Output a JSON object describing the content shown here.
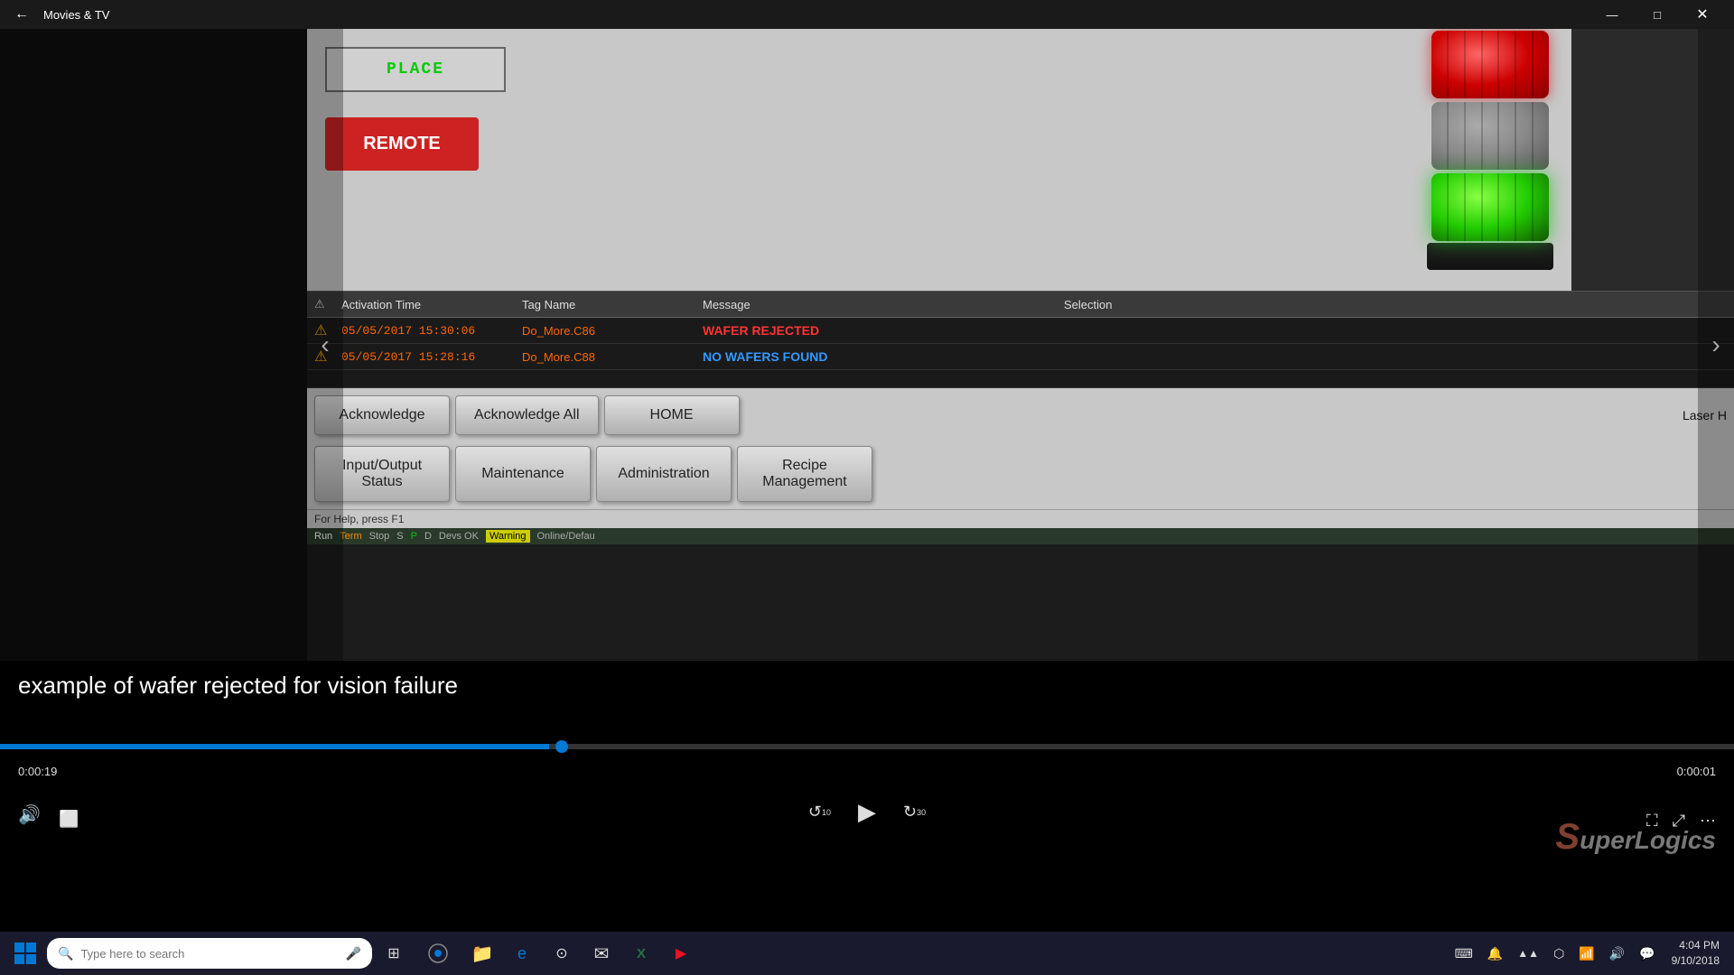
{
  "titlebar": {
    "title": "Movies & TV",
    "back_label": "←",
    "minimize": "—",
    "maximize": "□",
    "close": "✕"
  },
  "hmi": {
    "place_label": "PLACE",
    "remote_label": "REMOTE",
    "alarm_headers": {
      "icon": "",
      "activation_time": "Activation Time",
      "tag_name": "Tag Name",
      "message": "Message",
      "selection": "Selection"
    },
    "alarms": [
      {
        "time": "05/05/2017 15:30:06",
        "tag": "Do_More.C86",
        "message": "WAFER REJECTED"
      },
      {
        "time": "05/05/2017 15:28:16",
        "tag": "Do_More.C88",
        "message": "NO WAFERS FOUND"
      }
    ],
    "buttons_row1": [
      "Acknowledge",
      "Acknowledge All",
      "HOME"
    ],
    "laser_label": "Laser H",
    "buttons_row2": [
      "Input/Output\nStatus",
      "Maintenance",
      "Administration",
      "Recipe\nManagement"
    ],
    "help_text": "For Help, press F1",
    "status_bar": {
      "run": "Run",
      "term": "Term",
      "stop": "Stop",
      "s": "S",
      "p": "P",
      "d": "D",
      "devs_ok": "Devs OK",
      "warning": "Warning",
      "online": "Online/Defau"
    }
  },
  "caption": "example of wafer rejected for vision failure",
  "player": {
    "time_current": "0:00:19",
    "time_total": "0:00:01",
    "progress_pct": 31.67
  },
  "watermark": {
    "prefix": "S",
    "suffix": "uperLogics"
  },
  "taskbar": {
    "search_placeholder": "Type here to search",
    "clock_time": "4:04 PM",
    "clock_date": "9/10/2018"
  },
  "taskbar_icons": [
    "⊞",
    "🔍",
    "⊡",
    "📁",
    "🌐",
    "📧",
    "📊",
    "🎬"
  ],
  "tray_icons": [
    "⌨",
    "🔔",
    "🔧",
    "🔋",
    "📶",
    "🔊",
    "🕐"
  ]
}
